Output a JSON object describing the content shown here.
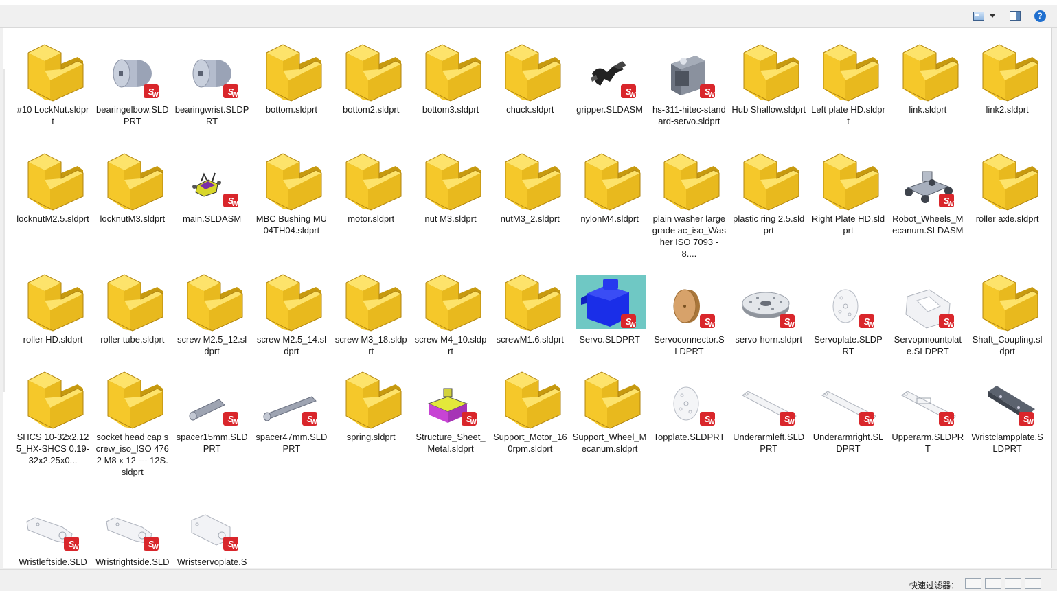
{
  "toolbar": {
    "view_icon": "view-options-icon",
    "pane_icon": "preview-pane-icon",
    "help_label": "?"
  },
  "status": {
    "quick_filter_label": "快速过滤器："
  },
  "files": [
    {
      "name": "#10 LockNut.sldprt",
      "icon": "folder-part"
    },
    {
      "name": "bearingelbow.SLDPRT",
      "icon": "disc"
    },
    {
      "name": "bearingwrist.SLDPRT",
      "icon": "disc"
    },
    {
      "name": "bottom.sldprt",
      "icon": "folder-part"
    },
    {
      "name": "bottom2.sldprt",
      "icon": "folder-part"
    },
    {
      "name": "bottom3.sldprt",
      "icon": "folder-part"
    },
    {
      "name": "chuck.sldprt",
      "icon": "folder-part"
    },
    {
      "name": "gripper.SLDASM",
      "icon": "gripper"
    },
    {
      "name": "hs-311-hitec-standard-servo.sldprt",
      "icon": "servo-gray"
    },
    {
      "name": "Hub Shallow.sldprt",
      "icon": "folder-part"
    },
    {
      "name": "Left plate HD.sldprt",
      "icon": "folder-part"
    },
    {
      "name": "link.sldprt",
      "icon": "folder-part"
    },
    {
      "name": "link2.sldprt",
      "icon": "folder-part"
    },
    {
      "name": "locknutM2.5.sldprt",
      "icon": "folder-part"
    },
    {
      "name": "locknutM3.sldprt",
      "icon": "folder-part"
    },
    {
      "name": "main.SLDASM",
      "icon": "assembly-small"
    },
    {
      "name": "MBC Bushing MU04TH04.sldprt",
      "icon": "folder-part"
    },
    {
      "name": "motor.sldprt",
      "icon": "folder-part"
    },
    {
      "name": "nut M3.sldprt",
      "icon": "folder-part"
    },
    {
      "name": "nutM3_2.sldprt",
      "icon": "folder-part"
    },
    {
      "name": "nylonM4.sldprt",
      "icon": "folder-part"
    },
    {
      "name": "plain washer large grade ac_iso_Washer ISO 7093 - 8....",
      "icon": "folder-part"
    },
    {
      "name": "plastic ring 2.5.sldprt",
      "icon": "folder-part"
    },
    {
      "name": "Right Plate HD.sldprt",
      "icon": "folder-part"
    },
    {
      "name": "Robot_Wheels_Mecanum.SLDASM",
      "icon": "robot"
    },
    {
      "name": "roller axle.sldprt",
      "icon": "folder-part"
    },
    {
      "name": "roller HD.sldprt",
      "icon": "folder-part"
    },
    {
      "name": "roller tube.sldprt",
      "icon": "folder-part"
    },
    {
      "name": "screw M2.5_12.sldprt",
      "icon": "folder-part"
    },
    {
      "name": "screw M2.5_14.sldprt",
      "icon": "folder-part"
    },
    {
      "name": "screw M3_18.sldprt",
      "icon": "folder-part"
    },
    {
      "name": "screw M4_10.sldprt",
      "icon": "folder-part"
    },
    {
      "name": "screwM1.6.sldprt",
      "icon": "folder-part"
    },
    {
      "name": "Servo.SLDPRT",
      "icon": "servo-blue"
    },
    {
      "name": "Servoconnector.SLDPRT",
      "icon": "wood-disc"
    },
    {
      "name": "servo-horn.sldprt",
      "icon": "horn"
    },
    {
      "name": "Servoplate.SLDPRT",
      "icon": "plate-round"
    },
    {
      "name": "Servopmountplate.SLDPRT",
      "icon": "plate-mount"
    },
    {
      "name": "Shaft_Coupling.sldprt",
      "icon": "folder-part"
    },
    {
      "name": "SHCS 10-32x2.125_HX-SHCS 0.19-32x2.25x0...",
      "icon": "folder-part"
    },
    {
      "name": "socket head cap screw_iso_ISO 4762 M8 x 12 --- 12S.sldprt",
      "icon": "folder-part"
    },
    {
      "name": "spacer15mm.SLDPRT",
      "icon": "spacer-short"
    },
    {
      "name": "spacer47mm.SLDPRT",
      "icon": "spacer-long"
    },
    {
      "name": "spring.sldprt",
      "icon": "folder-part"
    },
    {
      "name": "Structure_Sheet_Metal.sldprt",
      "icon": "sheet-metal"
    },
    {
      "name": "Support_Motor_160rpm.sldprt",
      "icon": "folder-part"
    },
    {
      "name": "Support_Wheel_Mecanum.sldprt",
      "icon": "folder-part"
    },
    {
      "name": "Topplate.SLDPRT",
      "icon": "plate-round"
    },
    {
      "name": "Underarmleft.SLDPRT",
      "icon": "arm"
    },
    {
      "name": "Underarmright.SLDPRT",
      "icon": "arm"
    },
    {
      "name": "Upperarm.SLDPRT",
      "icon": "arm-upper"
    },
    {
      "name": "Wristclampplate.SLDPRT",
      "icon": "clamp"
    },
    {
      "name": "Wristleftside.SLDPRT",
      "icon": "wrist"
    },
    {
      "name": "Wristrightside.SLDPRT",
      "icon": "wrist"
    },
    {
      "name": "Wristservoplate.SLDPRT",
      "icon": "wrist-plate"
    }
  ],
  "colors": {
    "folder_yellow": "#f5c82a",
    "folder_dark": "#c79a10",
    "sw_badge": "#d9262b",
    "servo_blue": "#1a2ee8",
    "servo_bg": "#6fc8c4"
  }
}
